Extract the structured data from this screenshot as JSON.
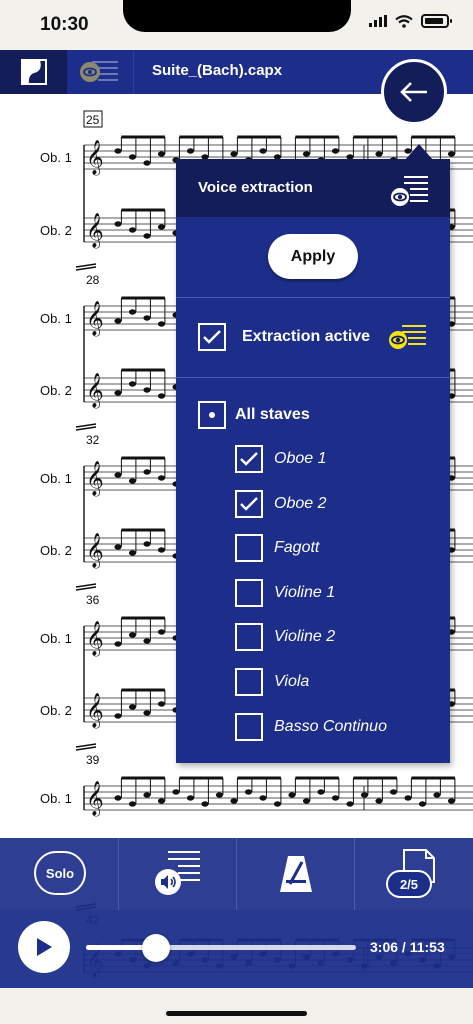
{
  "status_bar": {
    "time": "10:30"
  },
  "toolbar": {
    "document_title": "Suite_(Bach).capx"
  },
  "score": {
    "systems": [
      {
        "measure": "25",
        "staves": [
          "Ob. 1",
          "Ob. 2"
        ]
      },
      {
        "measure": "28",
        "staves": [
          "Ob. 1",
          "Ob. 2"
        ]
      },
      {
        "measure": "32",
        "staves": [
          "Ob. 1",
          "Ob. 2"
        ]
      },
      {
        "measure": "36",
        "staves": [
          "Ob. 1",
          "Ob. 2"
        ]
      },
      {
        "measure": "39",
        "staves": [
          "Ob. 1"
        ]
      },
      {
        "measure": "42",
        "staves": []
      }
    ]
  },
  "panel": {
    "title": "Voice extraction",
    "apply_label": "Apply",
    "extraction_active_label": "Extraction active",
    "extraction_active_checked": true,
    "all_staves_label": "All staves",
    "staves": [
      {
        "label": "Oboe 1",
        "checked": true
      },
      {
        "label": "Oboe 2",
        "checked": true
      },
      {
        "label": "Fagott",
        "checked": false
      },
      {
        "label": "Violine 1",
        "checked": false
      },
      {
        "label": "Violine 2",
        "checked": false
      },
      {
        "label": "Viola",
        "checked": false
      },
      {
        "label": "Basso Continuo",
        "checked": false
      }
    ]
  },
  "bottom_bar": {
    "solo_label": "Solo",
    "page_indicator": "2/5"
  },
  "player": {
    "time_readout": "3:06 / 11:53",
    "progress_fraction": 0.26
  },
  "colors": {
    "primary": "#1c2e8a",
    "primary_dark": "#131d5a",
    "accent_yellow": "#f2e21a",
    "background": "#f2f1ec"
  }
}
